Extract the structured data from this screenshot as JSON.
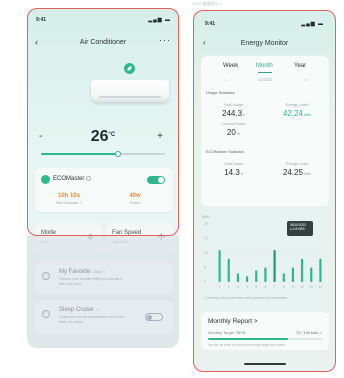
{
  "captions": {
    "left": "",
    "right": "ECO 能量统计 1"
  },
  "colors": {
    "accent": "#2fb98a",
    "eco_value": "#e58a2f",
    "highlight_frame": "#e06060"
  },
  "left": {
    "status": {
      "time": "9:41",
      "icons": "signal-wifi-battery-icons"
    },
    "title": "Air Conditioner",
    "temperature": {
      "value": "26",
      "unit": "°C",
      "minus": "-",
      "plus": "+",
      "slider_level": 0.62
    },
    "eco": {
      "label": "ECOMaster",
      "toggle_on": true,
      "stats": [
        {
          "value": "10h 10s",
          "label": "Time Estimate ⓘ"
        },
        {
          "value": "40w",
          "label": "Power"
        }
      ]
    },
    "controls": [
      {
        "title": "Mode",
        "sub": "Cool",
        "icon": "snowflake-icon"
      },
      {
        "title": "Fan Speed",
        "sub": "High Wind",
        "icon": "fan-icon"
      }
    ],
    "favorite": {
      "title": "My Favorite",
      "badge": "Daily ⓘ",
      "desc": "Choose your favorite setting to activate it with one touch"
    },
    "sleep": {
      "title": "Sleep Cruise",
      "badge": "ⓘ",
      "desc": "Customize the set temperature for 8 hours while you sleep"
    }
  },
  "right": {
    "status": {
      "time": "9:41",
      "icons": "signal-wifi-battery-icons"
    },
    "title": "Energy Monitor",
    "tabs": [
      "Week",
      "Month",
      "Year"
    ],
    "active_tab": "Month",
    "date": {
      "prev": "<",
      "value": "12/2023",
      "next": ">"
    },
    "usage_title": "Usage Statistics",
    "usage": [
      {
        "label": "Total Usage",
        "value": "244.3",
        "unit": "h"
      },
      {
        "label": "Energy Used",
        "value": "42.24",
        "unit": "kWh"
      }
    ],
    "current_power": {
      "label": "Current Power",
      "value": "20",
      "unit": "W"
    },
    "ecomaster_title": "ECOMaster Statistics",
    "eco_stats": [
      {
        "label": "Total Hours",
        "value": "14.3",
        "unit": "h"
      },
      {
        "label": "Energy Used",
        "value": "24.25",
        "unit": "kWh"
      }
    ],
    "eco_tooltip": {
      "line1": "06/10/2023",
      "line2": "● 4.8 kWh"
    },
    "chart_note": "* Counting only hours when unit is powered on and online",
    "report": {
      "title": "Monthly Report",
      "arrow": ">",
      "target_label": "Monthly Target",
      "target_pct": "70 %",
      "right_text": "70 / 100 kwh >",
      "progress": 0.7,
      "note": "You are on track to meet your energy target this month"
    }
  },
  "chart_data": {
    "type": "bar",
    "categories": [
      "1",
      "2",
      "3",
      "4",
      "5",
      "6",
      "7",
      "8",
      "9",
      "10",
      "11",
      "12"
    ],
    "values": [
      11,
      8,
      3,
      2,
      4,
      5,
      11,
      3,
      5,
      8,
      5,
      8
    ],
    "ylabel": "kWh",
    "ylim": [
      0,
      20
    ],
    "yticks": [
      "20",
      "15",
      "10",
      "5",
      "0"
    ],
    "highlight_index": 6,
    "grid": true
  }
}
